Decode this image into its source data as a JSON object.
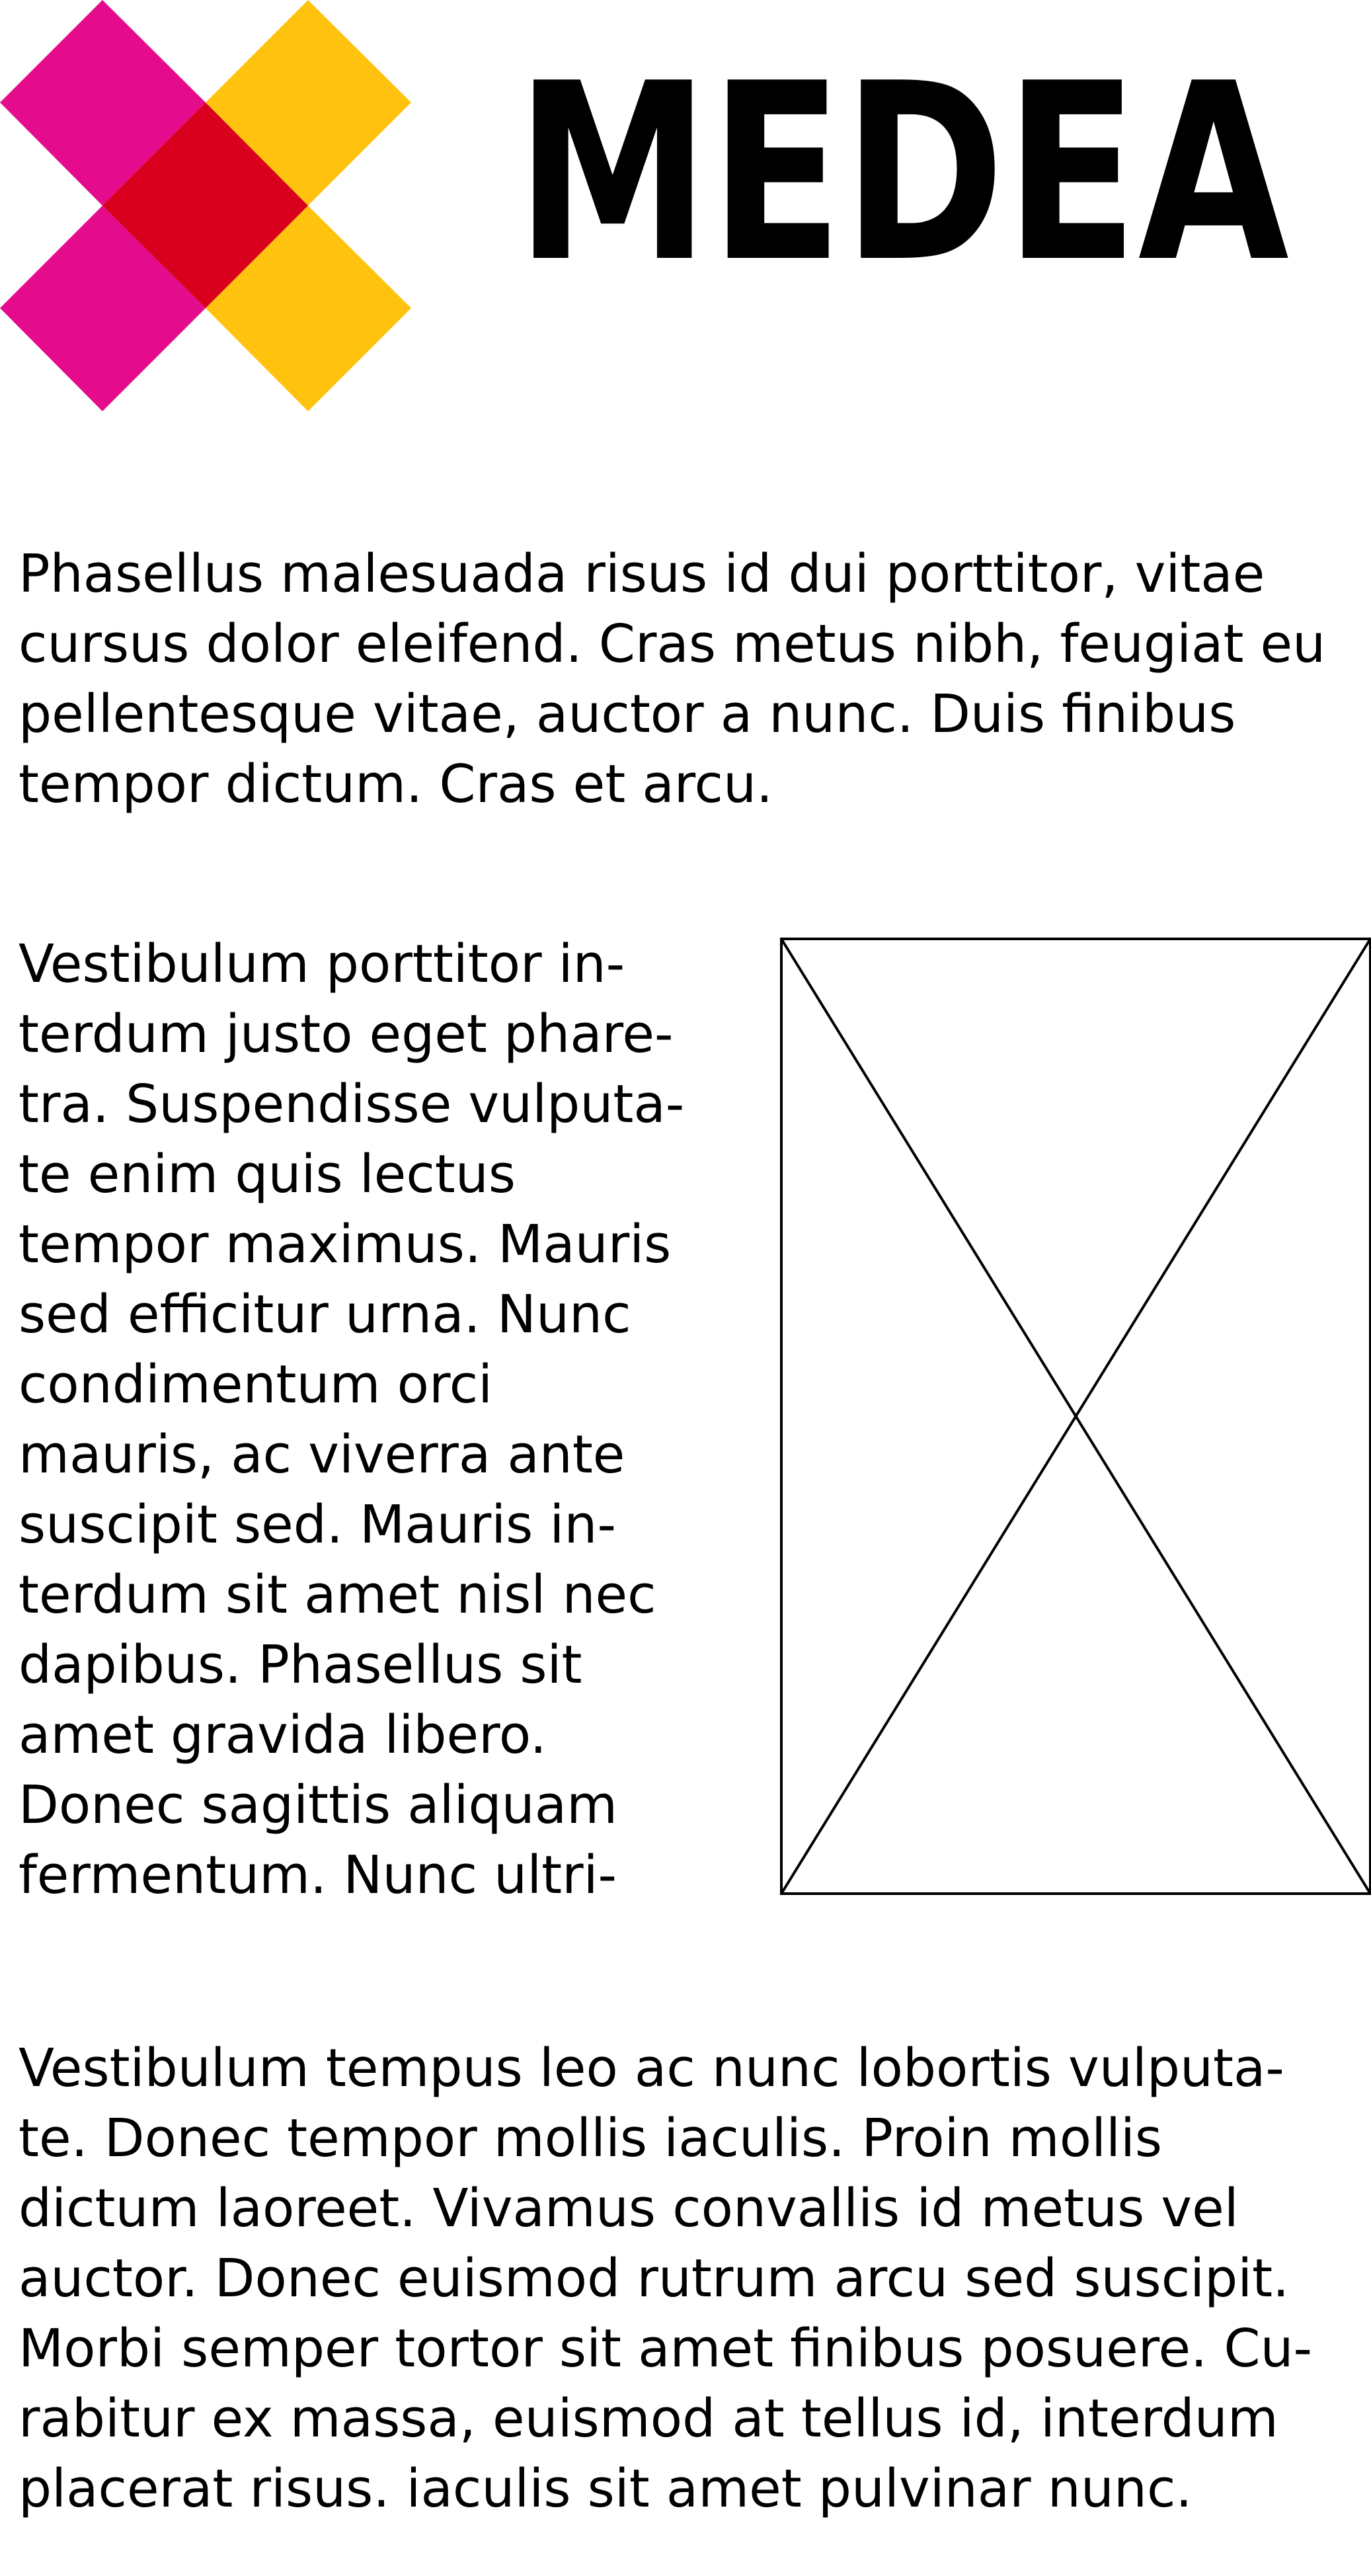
{
  "brand": {
    "name": "MEDEA",
    "colors": {
      "magenta": "#E40C8C",
      "yellow": "#FFC20E",
      "overlap_red": "#D8001C",
      "text": "#000000"
    },
    "logo_icon": "x-cross-logo"
  },
  "paragraphs": {
    "intro": [
      "Phasellus malesuada risus id dui porttitor, vitae",
      "cursus dolor eleifend. Cras metus nibh, feugiat eu",
      "pellentesque vitae, auctor a nunc. Duis finibus",
      "tempor dictum. Cras et arcu."
    ],
    "column": [
      "Vestibulum porttitor in-",
      "terdum justo eget phare-",
      "tra. Suspendisse vulputa-",
      "te enim quis lectus",
      "tempor maximus. Mauris",
      "sed efficitur urna. Nunc",
      "condimentum orci",
      "mauris, ac viverra ante",
      "suscipit sed. Mauris in-",
      "terdum sit amet nisl nec",
      "dapibus. Phasellus sit",
      "amet gravida libero.",
      "Donec sagittis aliquam",
      "fermentum. Nunc ultri-"
    ],
    "closing": [
      "Vestibulum tempus leo ac nunc lobortis vulputa-",
      "te. Donec tempor mollis iaculis. Proin mollis",
      "dictum laoreet. Vivamus convallis id metus vel",
      "auctor. Donec euismod rutrum arcu sed suscipit.",
      "Morbi semper tortor sit amet finibus posuere. Cu-",
      "rabitur ex massa, euismod at tellus id, interdum",
      "placerat risus. iaculis sit amet pulvinar nunc."
    ]
  },
  "image_placeholder": {
    "icon": "image-placeholder-icon"
  }
}
